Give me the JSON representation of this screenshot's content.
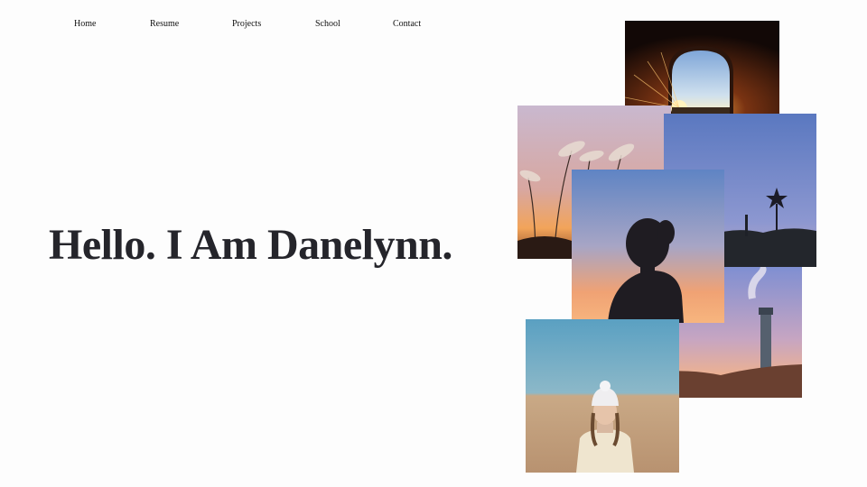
{
  "nav": {
    "items": [
      {
        "label": "Home",
        "name": "nav-home"
      },
      {
        "label": "Resume",
        "name": "nav-resume"
      },
      {
        "label": "Projects",
        "name": "nav-projects"
      },
      {
        "label": "School",
        "name": "nav-school"
      },
      {
        "label": "Contact",
        "name": "nav-contact"
      }
    ]
  },
  "hero": {
    "title": "Hello. I Am Danelynn."
  },
  "colors": {
    "background": "#fdfdfd",
    "text": "#25252b",
    "sky_blue": "#5f84c4",
    "sunset_orange": "#f0a274",
    "sand": "#c4a07a"
  }
}
